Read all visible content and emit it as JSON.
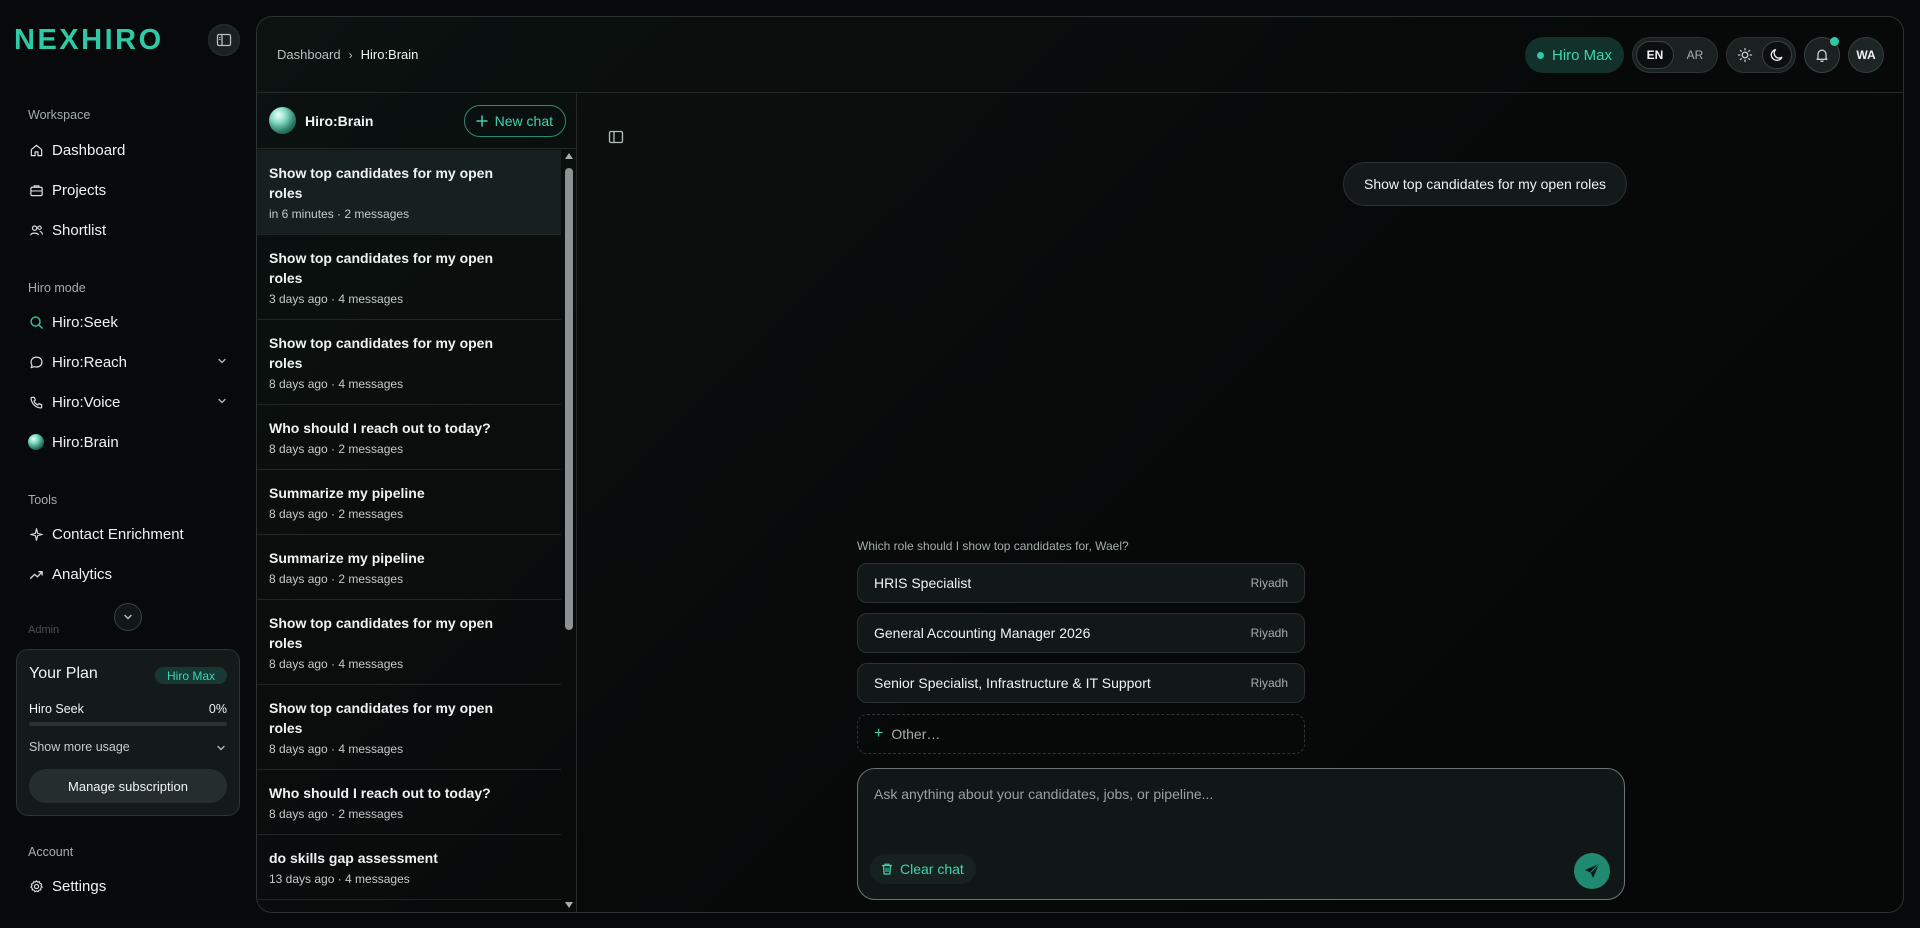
{
  "brand": {
    "logo": "NEXHIRO"
  },
  "nav": {
    "workspace_label": "Workspace",
    "workspace": [
      {
        "label": "Dashboard",
        "icon": "home-icon"
      },
      {
        "label": "Projects",
        "icon": "briefcase-icon"
      },
      {
        "label": "Shortlist",
        "icon": "users-icon"
      }
    ],
    "mode_label": "Hiro mode",
    "modes": [
      {
        "label": "Hiro:Seek",
        "icon": "search-icon"
      },
      {
        "label": "Hiro:Reach",
        "icon": "message-icon"
      },
      {
        "label": "Hiro:Voice",
        "icon": "phone-icon"
      },
      {
        "label": "Hiro:Brain",
        "icon": "orb-icon"
      }
    ],
    "tools_label": "Tools",
    "tools": [
      {
        "label": "Contact Enrichment",
        "icon": "sparkle-icon"
      },
      {
        "label": "Analytics",
        "icon": "trend-icon"
      }
    ],
    "faded_label": "Admin",
    "account_label": "Account",
    "account": [
      {
        "label": "Settings",
        "icon": "gear-icon"
      }
    ]
  },
  "plan": {
    "title": "Your Plan",
    "badge": "Hiro Max",
    "usage_label": "Hiro Seek",
    "usage_pct": "0%",
    "usage_fraction": 0,
    "more_label": "Show more usage",
    "manage_label": "Manage subscription"
  },
  "header": {
    "breadcrumb_parent": "Dashboard",
    "breadcrumb_current": "Hiro:Brain",
    "plan_pill": "Hiro Max",
    "lang_en": "EN",
    "lang_ar": "AR",
    "avatar": "WA"
  },
  "chatlist": {
    "title": "Hiro:Brain",
    "new_chat": "New chat",
    "conversations": [
      {
        "title": "Show top candidates for my open roles",
        "meta": "in 6 minutes  · 2 messages"
      },
      {
        "title": "Show top candidates for my open roles",
        "meta": "3 days ago  · 4 messages"
      },
      {
        "title": "Show top candidates for my open roles",
        "meta": "8 days ago  · 4 messages"
      },
      {
        "title": "Who should I reach out to today?",
        "meta": "8 days ago  · 2 messages"
      },
      {
        "title": "Summarize my pipeline",
        "meta": "8 days ago  · 2 messages"
      },
      {
        "title": "Summarize my pipeline",
        "meta": "8 days ago  · 2 messages"
      },
      {
        "title": "Show top candidates for my open roles",
        "meta": "8 days ago  · 4 messages"
      },
      {
        "title": "Show top candidates for my open roles",
        "meta": "8 days ago  · 4 messages"
      },
      {
        "title": "Who should I reach out to today?",
        "meta": "8 days ago  · 2 messages"
      },
      {
        "title": "do skills gap assessment",
        "meta": "13 days ago  · 4 messages"
      }
    ]
  },
  "chat": {
    "user_message": "Show top candidates for my open roles",
    "question": "Which role should I show top candidates for, Wael?",
    "options": [
      {
        "label": "HRIS Specialist",
        "location": "Riyadh"
      },
      {
        "label": "General Accounting Manager 2026",
        "location": "Riyadh"
      },
      {
        "label": "Senior Specialist, Infrastructure & IT Support",
        "location": "Riyadh"
      }
    ],
    "other_label": "Other…",
    "composer_placeholder": "Ask anything about your candidates, jobs, or pipeline...",
    "clear_label": "Clear chat"
  },
  "colors": {
    "accent": "#2fc9a6",
    "background": "#07090a"
  }
}
